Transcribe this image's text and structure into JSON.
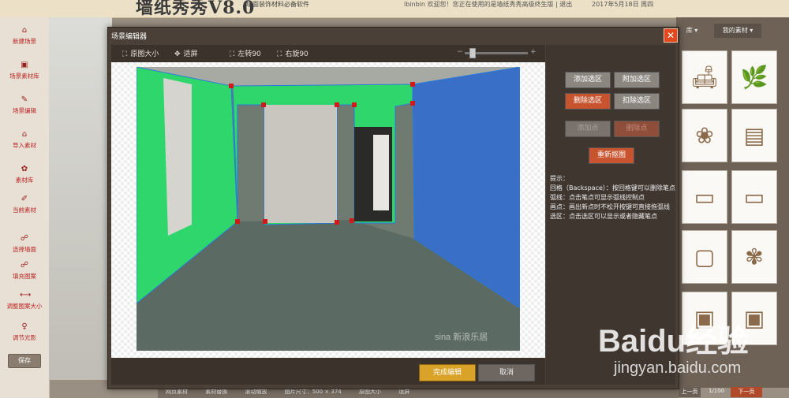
{
  "app": {
    "logo": "墙纸秀秀V8.0",
    "slogan": "墙面装饰材料必备软件",
    "welcome": "lbinbin 欢迎您！您正在使用的是墙纸秀秀高级终生版 | 退出",
    "date": "2017年5月18日 周四"
  },
  "sidebar": {
    "items": [
      {
        "label": "新建场景",
        "icon": "home-icon"
      },
      {
        "label": "场景素材库",
        "icon": "image-icon"
      },
      {
        "label": "场景编辑",
        "icon": "edit-icon"
      },
      {
        "label": "导入素材",
        "icon": "import-icon"
      },
      {
        "label": "素材库",
        "icon": "library-icon"
      },
      {
        "label": "当前素材",
        "icon": "current-icon"
      },
      {
        "label": "选择墙面",
        "icon": "select-wall-icon"
      },
      {
        "label": "填充图案",
        "icon": "fill-icon"
      },
      {
        "label": "调整图案大小",
        "icon": "resize-icon"
      },
      {
        "label": "调节光影",
        "icon": "light-icon"
      }
    ],
    "save": "保存"
  },
  "right_panel": {
    "tab1": "库",
    "tab2": "我的素材"
  },
  "bottombar": {
    "items": [
      "网页素材",
      "素材替换",
      "滚动缩放",
      "图片尺寸：500 × 374",
      "原图大小",
      "适屏"
    ],
    "pager": "1/100",
    "next": "下一页",
    "prev": "上一页"
  },
  "modal": {
    "title": "场景编辑器",
    "toolbar": {
      "original_size": "原图大小",
      "fit_screen": "适屏",
      "rotate_left": "左转90",
      "rotate_right": "右旋90"
    },
    "buttons": {
      "add_selection": "添加选区",
      "append_selection": "附加选区",
      "delete_selection": "删除选区",
      "subtract_selection": "扣除选区",
      "disabled1": "添加点",
      "disabled2": "删除点",
      "redraw": "重新抠图"
    },
    "hints": {
      "title": "提示：",
      "line1": "回格（Backspace）：按回格键可以删除笔点",
      "line2": "弧线：点击笔点可显示弧线控制点",
      "line3": "画点：画出新点时不松开按键可直接拖弧线",
      "line4": "选区：点击选区可以显示或者隐藏笔点"
    },
    "finish": "完成编辑",
    "cancel": "取消",
    "photo_watermark": "sina 新浪乐居"
  },
  "watermark": {
    "logo": "Baidu经验",
    "url": "jingyan.baidu.com"
  },
  "colors": {
    "accent_red": "#e04a1e",
    "wall_green": "#2fd66b",
    "wall_blue": "#3a6fc8"
  }
}
